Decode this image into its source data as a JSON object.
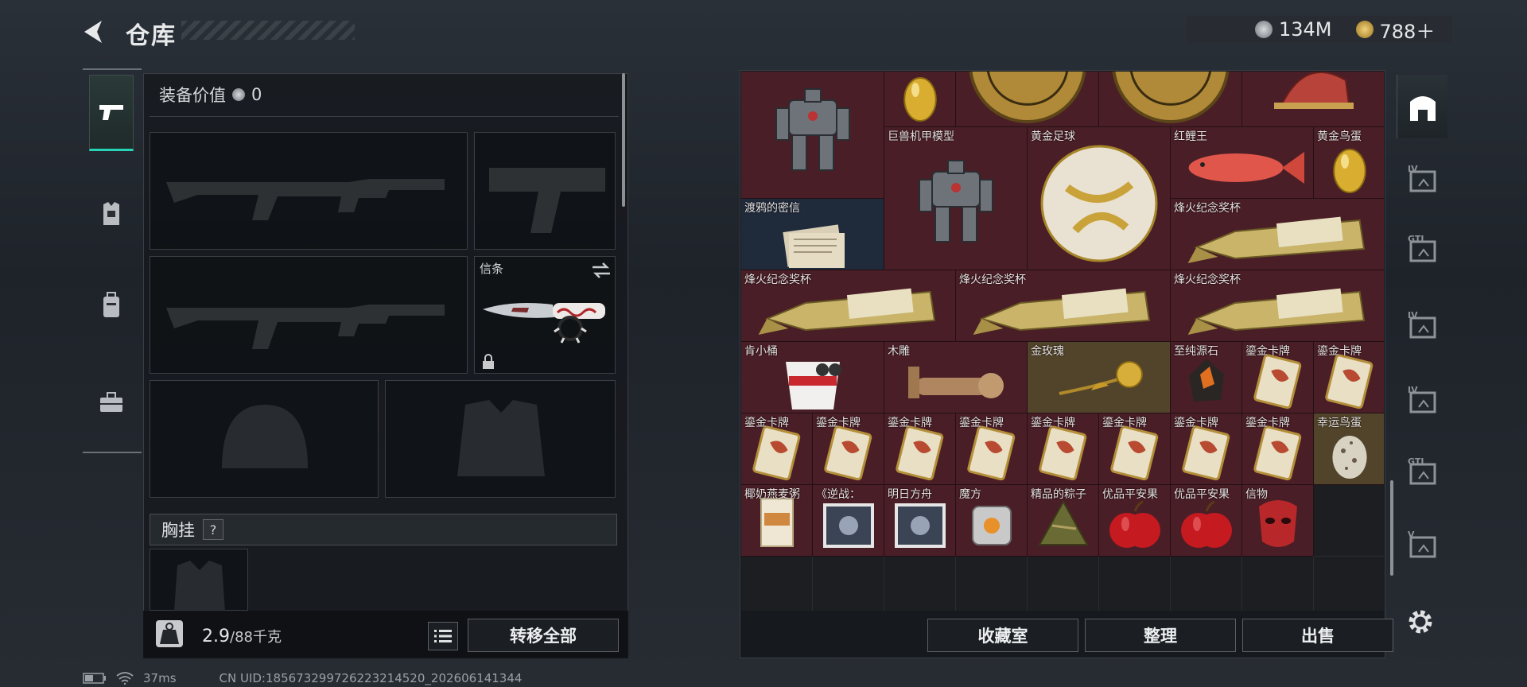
{
  "header": {
    "title": "仓库"
  },
  "currency": {
    "silver": "134M",
    "gold": "788＋"
  },
  "left_tabs": [
    "weapons-icon",
    "armor-icon",
    "backpack-icon",
    "toolbox-icon"
  ],
  "equipment": {
    "value_label": "装备价值",
    "value": "0",
    "melee_name": "信条",
    "chest_rig_label": "胸挂",
    "chest_rig_help": "?",
    "weight_value": "2.9",
    "weight_capacity": "/88千克",
    "transfer_all": "转移全部"
  },
  "stash": {
    "items": [
      {
        "name": "巨兽机甲模型",
        "kind": "mech"
      },
      {
        "name": "黄金鸟蛋",
        "kind": "egg"
      },
      {
        "name": "",
        "kind": "coin"
      },
      {
        "name": "",
        "kind": "coin"
      },
      {
        "name": "",
        "kind": "horse"
      },
      {
        "name": "巨兽机甲模型",
        "kind": "mech"
      },
      {
        "name": "黄金足球",
        "kind": "ball"
      },
      {
        "name": "红鲤王",
        "kind": "fish"
      },
      {
        "name": "黄金鸟蛋",
        "kind": "egg"
      },
      {
        "name": "渡鸦的密信",
        "kind": "letter"
      },
      {
        "name": "烽火纪念奖杯",
        "kind": "trophy"
      },
      {
        "name": "烽火纪念奖杯",
        "kind": "trophy"
      },
      {
        "name": "烽火纪念奖杯",
        "kind": "trophy"
      },
      {
        "name": "烽火纪念奖杯",
        "kind": "trophy"
      },
      {
        "name": "肯小桶",
        "kind": "bucket"
      },
      {
        "name": "木雕",
        "kind": "carving"
      },
      {
        "name": "金玫瑰",
        "kind": "rose"
      },
      {
        "name": "至纯源石",
        "kind": "stone"
      },
      {
        "name": "鎏金卡牌",
        "kind": "card"
      },
      {
        "name": "鎏金卡牌",
        "kind": "card"
      },
      {
        "name": "鎏金卡牌",
        "kind": "card"
      },
      {
        "name": "鎏金卡牌",
        "kind": "card"
      },
      {
        "name": "鎏金卡牌",
        "kind": "card"
      },
      {
        "name": "鎏金卡牌",
        "kind": "card"
      },
      {
        "name": "鎏金卡牌",
        "kind": "card"
      },
      {
        "name": "鎏金卡牌",
        "kind": "card"
      },
      {
        "name": "鎏金卡牌",
        "kind": "card"
      },
      {
        "name": "鎏金卡牌",
        "kind": "card"
      },
      {
        "name": "幸运鸟蛋",
        "kind": "spotted-egg"
      },
      {
        "name": "椰奶燕麦粥",
        "kind": "porridge"
      },
      {
        "name": "《逆战：",
        "kind": "cd"
      },
      {
        "name": "明日方舟",
        "kind": "cd"
      },
      {
        "name": "魔方",
        "kind": "cube"
      },
      {
        "name": "精品的粽子",
        "kind": "zongzi"
      },
      {
        "name": "优品平安果",
        "kind": "apple"
      },
      {
        "name": "优品平安果",
        "kind": "apple"
      },
      {
        "name": "信物",
        "kind": "mask"
      }
    ]
  },
  "stash_buttons": {
    "collection": "收藏室",
    "sort": "整理",
    "sell": "出售"
  },
  "right_tabs": [
    "storage-icon",
    "stash-tab-icon",
    "stash-tab-icon",
    "stash-tab-icon",
    "stash-tab-icon",
    "stash-tab-icon",
    "stash-tab-icon"
  ],
  "right_tab_labels": [
    "",
    "IV",
    "GTI",
    "IV",
    "IV",
    "GTI",
    "V"
  ],
  "status": {
    "ping": "37ms",
    "uid": "CN UID:18567329972622321452​0_202606141344"
  },
  "colors": {
    "accent": "#27d3b4",
    "item_red": "#4a1e26",
    "item_gold": "#52442a"
  }
}
